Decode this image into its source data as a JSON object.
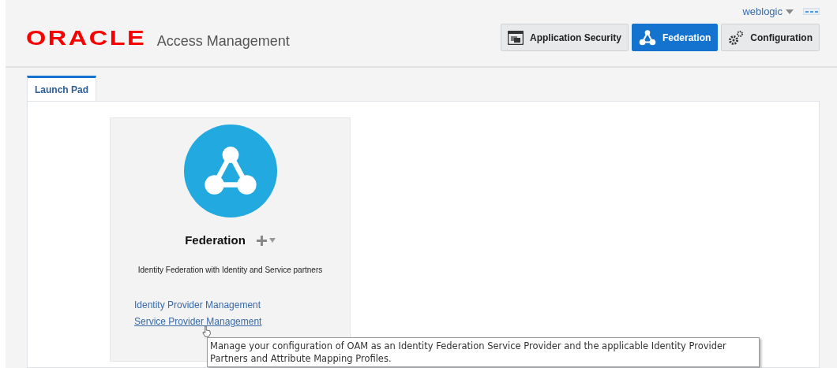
{
  "header": {
    "user_menu": "weblogic",
    "logo": "ORACLE",
    "product": "Access Management",
    "nav": [
      {
        "label": "Application Security",
        "kind": "window",
        "selected": false
      },
      {
        "label": "Federation",
        "kind": "federation",
        "selected": true
      },
      {
        "label": "Configuration",
        "kind": "gears",
        "selected": false
      }
    ]
  },
  "tabs": [
    {
      "label": "Launch Pad",
      "selected": true
    }
  ],
  "card": {
    "title": "Federation",
    "description": "Identity Federation with Identity and Service partners",
    "links": [
      {
        "label": "Identity Provider Management",
        "hovered": false
      },
      {
        "label": "Service Provider Management",
        "hovered": true
      }
    ]
  },
  "tooltip": "Manage your configuration of OAM as an Identity Federation Service Provider and the applicable Identity Provider Partners and Attribute Mapping Profiles."
}
